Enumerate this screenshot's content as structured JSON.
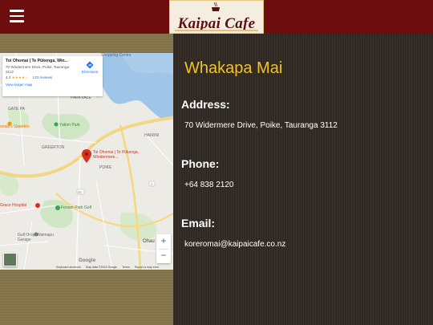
{
  "header": {
    "logo_text": "Kaipai Cafe",
    "menu_icon": "hamburger-menu-icon"
  },
  "map": {
    "place_name": "Toi Ohomai | Te Pūkenga, Win...",
    "address": "70 Windermere Drive, Poike, Tauranga 3112",
    "rating": "4.2",
    "stars": "★★★★☆",
    "reviews": "123 reviews",
    "view_larger": "View larger map",
    "directions": "Directions",
    "pin_label": "Toi Ohomai | Te Pūkenga, Windermere...",
    "labels": {
      "shopping_centre": "Shopping Centre",
      "parkvale": "PARKVALE",
      "gate_pa": "GATE PA",
      "mcdonalds": "onald's Greerton",
      "yatton_park": "Yatton Park",
      "greerton": "GREERTON",
      "poike": "POIKE",
      "hairini": "HAIRINI",
      "grace_hospital": "Grace Hospital",
      "fenner_park": "Fenner Park Golf",
      "gull_oropi": "Gull Oropi Waimapu Garage",
      "ohau": "Ohau",
      "road_29": "29",
      "road_2": "2"
    },
    "zoom_in": "+",
    "zoom_out": "−",
    "google": "Google",
    "attribution": [
      "Keyboard shortcuts",
      "Map data ©2023 Google",
      "Terms",
      "Report a map error"
    ]
  },
  "contact": {
    "title": "Whakapa Mai",
    "address_label": "Address:",
    "address_value": "70 Widermere Drive, Poike, Tauranga 3112",
    "phone_label": "Phone:",
    "phone_value": "+64 838 2120",
    "email_label": "Email:",
    "email_value": "koreromai@kaipaicafe.co.nz"
  },
  "colors": {
    "header_bg": "#6e0d0d",
    "title_yellow": "#f0c425",
    "panel_dark": "#2f2823",
    "pin_red": "#d93025",
    "link_blue": "#1a73e8"
  }
}
